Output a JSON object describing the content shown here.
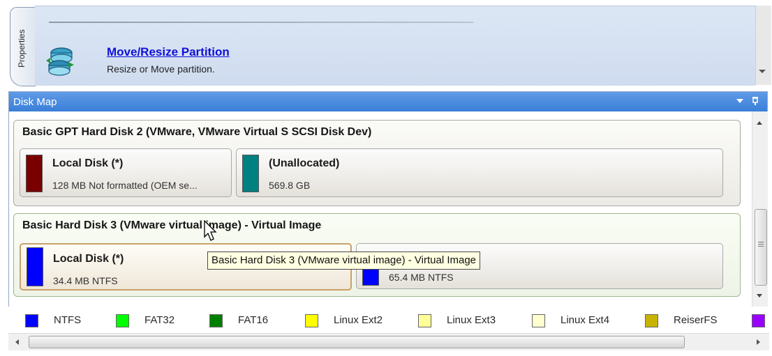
{
  "properties_tab": {
    "label": "Properties"
  },
  "operation": {
    "title": "Move/Resize Partition",
    "description": "Resize or Move partition."
  },
  "disk_map": {
    "title": "Disk Map",
    "disks": [
      {
        "title": "Basic GPT Hard Disk 2 (VMware, VMware Virtual S SCSI Disk Dev)",
        "partitions": [
          {
            "name": "Local Disk (*)",
            "info": "128 MB Not formatted (OEM se...",
            "color": "#7a0000"
          },
          {
            "name": "(Unallocated)",
            "info": "569.8 GB",
            "color": "#008080"
          }
        ]
      },
      {
        "title": "Basic Hard Disk 3 (VMware virtual image) - Virtual Image",
        "partitions": [
          {
            "name": "Local Disk (*)",
            "info": "34.4 MB NTFS",
            "color": "#0000ff"
          },
          {
            "name": "",
            "info": "65.4 MB NTFS",
            "color": "#0000ff"
          }
        ]
      }
    ],
    "tooltip": "Basic Hard Disk 3 (VMware virtual image) - Virtual Image"
  },
  "legend": [
    {
      "label": "NTFS",
      "color": "#0000ff"
    },
    {
      "label": "FAT32",
      "color": "#00ff00"
    },
    {
      "label": "FAT16",
      "color": "#008000"
    },
    {
      "label": "Linux Ext2",
      "color": "#ffff00"
    },
    {
      "label": "Linux Ext3",
      "color": "#ffff99"
    },
    {
      "label": "Linux Ext4",
      "color": "#ffffd0"
    },
    {
      "label": "ReiserFS",
      "color": "#c8b400"
    },
    {
      "label": "",
      "color": "#9900ff"
    }
  ],
  "icons": {
    "operation": "move-resize-icon",
    "cursor": "mouse-pointer-icon",
    "dropdown": "chevron-down-icon",
    "pin": "pin-icon"
  }
}
